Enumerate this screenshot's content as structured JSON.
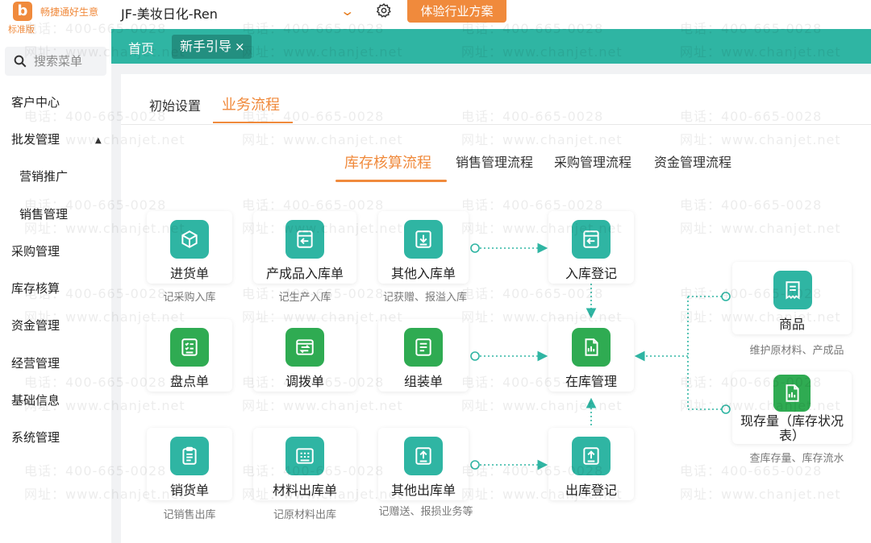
{
  "app": {
    "brand": "畅捷通好生意",
    "edition": "标准版",
    "company": "JF-美妆日化-Ren",
    "experience_button": "体验行业方案"
  },
  "tabs": {
    "home": "首页",
    "guide": "新手引导",
    "close_glyph": "×"
  },
  "sidebar": {
    "search_placeholder": "搜索菜单",
    "items": [
      "客户中心",
      "批发管理",
      "营销推广",
      "销售管理",
      "采购管理",
      "库存核算",
      "资金管理",
      "经营管理",
      "基础信息",
      "系统管理"
    ]
  },
  "subtabs": [
    "初始设置",
    "业务流程"
  ],
  "flow_tabs": [
    "库存核算流程",
    "销售管理流程",
    "采购管理流程",
    "资金管理流程"
  ],
  "cards": {
    "purchase_order": {
      "label": "进货单",
      "desc": "记采购入库",
      "icon": "box-icon"
    },
    "product_inbound": {
      "label": "产成品入库单",
      "desc": "记生产入库",
      "icon": "inbound-icon"
    },
    "other_inbound": {
      "label": "其他入库单",
      "desc": "记获赠、报溢入库",
      "icon": "download-icon"
    },
    "inbound_register": {
      "label": "入库登记",
      "icon": "inbound-icon"
    },
    "stocktake": {
      "label": "盘点单",
      "icon": "checklist-icon"
    },
    "transfer": {
      "label": "调拨单",
      "icon": "transfer-icon"
    },
    "assembly": {
      "label": "组装单",
      "icon": "document-icon"
    },
    "inventory_mgmt": {
      "label": "在库管理",
      "icon": "chart-doc-icon"
    },
    "sales_order": {
      "label": "销货单",
      "desc": "记销售出库",
      "icon": "clipboard-icon"
    },
    "material_outbound": {
      "label": "材料出库单",
      "desc": "记原材料出库",
      "icon": "grid-list-icon"
    },
    "other_outbound": {
      "label": "其他出库单",
      "desc": "记赠送、报损业务等",
      "icon": "upload-icon"
    },
    "outbound_register": {
      "label": "出库登记",
      "icon": "upload-icon"
    },
    "goods": {
      "label": "商品",
      "desc": "维护原材料、产成品",
      "icon": "receipt-icon"
    },
    "current_stock": {
      "label": "现存量（库存状况表）",
      "desc": "查库存量、库存流水",
      "icon": "chart-doc-icon"
    }
  },
  "watermark": {
    "phone": "电话：400-665-0028",
    "site": "网址：www.chanjet.net"
  },
  "colors": {
    "accent": "#f08a3c",
    "teal": "#2fb5a3",
    "green": "#2fab52"
  }
}
